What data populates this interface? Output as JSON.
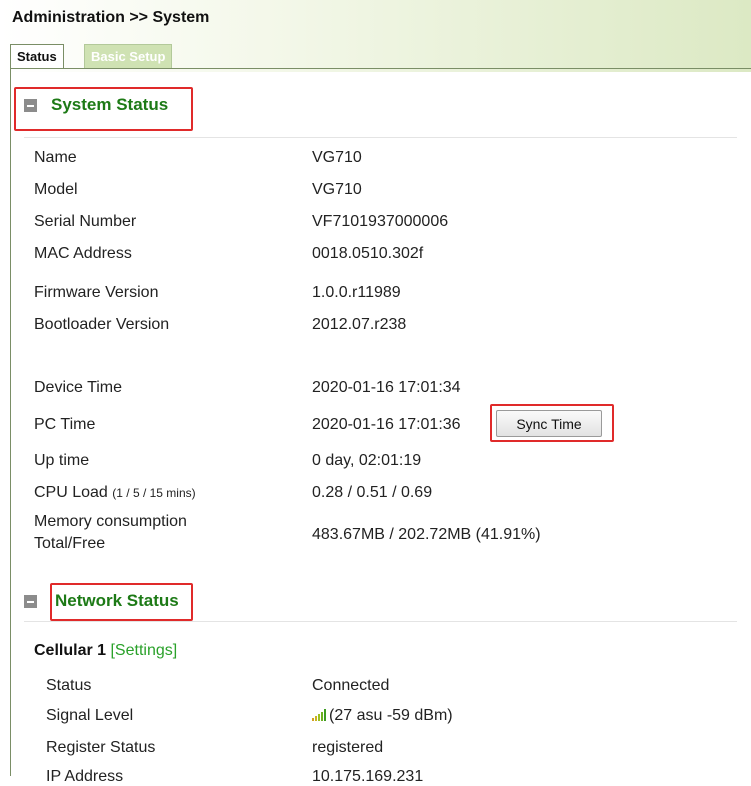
{
  "breadcrumb": "Administration >> System",
  "tabs": {
    "status": "Status",
    "basic_setup": "Basic Setup"
  },
  "system_status": {
    "title": "System Status",
    "rows": {
      "name": {
        "label": "Name",
        "value": "VG710"
      },
      "model": {
        "label": "Model",
        "value": "VG710"
      },
      "serial": {
        "label": "Serial Number",
        "value": "VF7101937000006"
      },
      "mac": {
        "label": "MAC Address",
        "value": "0018.0510.302f"
      },
      "firmware": {
        "label": "Firmware Version",
        "value": "1.0.0.r11989"
      },
      "bootloader": {
        "label": "Bootloader Version",
        "value": "2012.07.r238"
      },
      "device_time": {
        "label": "Device Time",
        "value": "2020-01-16 17:01:34"
      },
      "pc_time": {
        "label": "PC Time",
        "value": "2020-01-16 17:01:36"
      },
      "uptime": {
        "label": "Up time",
        "value": "0 day, 02:01:19"
      },
      "cpu_load": {
        "label": "CPU Load",
        "label_suffix": "(1 / 5 / 15 mins)",
        "value": "0.28 / 0.51 / 0.69"
      },
      "memory": {
        "label_line1": "Memory consumption",
        "label_line2": "Total/Free",
        "value": "483.67MB / 202.72MB (41.91%)"
      }
    },
    "sync_button": "Sync Time"
  },
  "network_status": {
    "title": "Network Status",
    "cellular": {
      "name": "Cellular 1",
      "settings_link": "[Settings]",
      "rows": {
        "status": {
          "label": "Status",
          "value": "Connected"
        },
        "signal": {
          "label": "Signal Level",
          "value": "(27 asu -59 dBm)"
        },
        "register": {
          "label": "Register Status",
          "value": "registered"
        },
        "ip": {
          "label": "IP Address",
          "value": "10.175.169.231"
        }
      }
    }
  },
  "colors": {
    "section_title": "#1d7a16",
    "highlight_box": "#e02a2a",
    "settings_link": "#2aa12a",
    "tab_inactive_bg": "#cfe2b3",
    "header_gradient_end": "#dce9c4",
    "signal_bars": [
      "#d4a020",
      "#c8b420",
      "#9cc020",
      "#6cb020",
      "#3c9c20"
    ]
  },
  "icons": {
    "section_toggle": "collapse-minus-icon",
    "signal": "signal-strength-icon"
  }
}
